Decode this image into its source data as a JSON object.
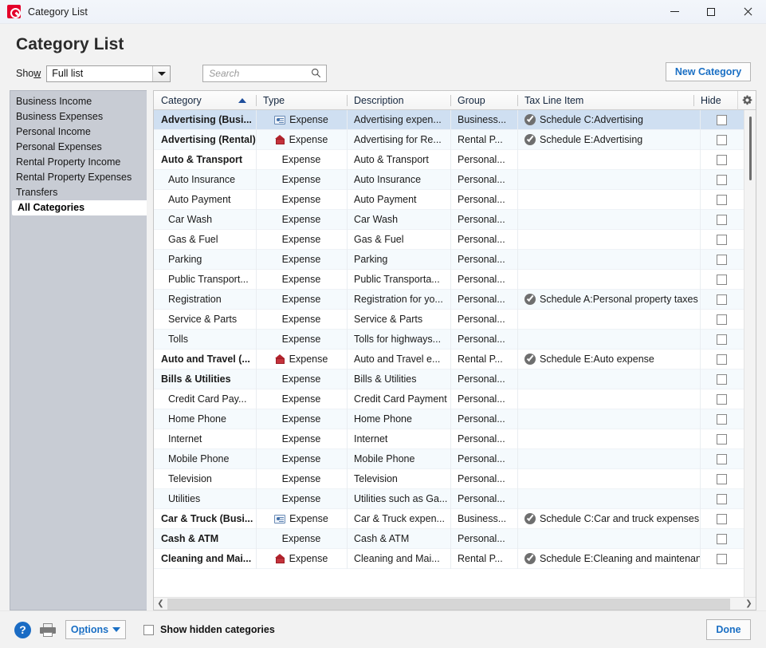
{
  "window": {
    "title": "Category List",
    "logo_icon": "quicken-logo-icon",
    "controls": {
      "minimize": "minimize-icon",
      "maximize": "maximize-icon",
      "close": "close-icon"
    }
  },
  "header": {
    "page_title": "Category List"
  },
  "filter": {
    "show_label_pre": "Sho",
    "show_label_underlined": "w",
    "show_value": "Full list",
    "show_options": [
      "Full list"
    ],
    "search_placeholder": "Search",
    "search_value": "",
    "search_icon": "search-icon",
    "new_category_label": "New Category"
  },
  "sidebar": {
    "items": [
      {
        "label": "Business Income",
        "selected": false
      },
      {
        "label": "Business Expenses",
        "selected": false
      },
      {
        "label": "Personal Income",
        "selected": false
      },
      {
        "label": "Personal Expenses",
        "selected": false
      },
      {
        "label": "Rental Property Income",
        "selected": false
      },
      {
        "label": "Rental Property Expenses",
        "selected": false
      },
      {
        "label": "Transfers",
        "selected": false
      },
      {
        "label": "All Categories",
        "selected": true
      }
    ]
  },
  "table": {
    "columns": [
      {
        "key": "category",
        "label": "Category",
        "sorted": "asc"
      },
      {
        "key": "type",
        "label": "Type"
      },
      {
        "key": "description",
        "label": "Description"
      },
      {
        "key": "group",
        "label": "Group"
      },
      {
        "key": "tax_line_item",
        "label": "Tax Line Item"
      },
      {
        "key": "hide",
        "label": "Hide"
      }
    ],
    "settings_icon": "gear-icon",
    "rows": [
      {
        "category": "Advertising (Busi...",
        "bold": true,
        "indent": false,
        "type_icon": "business-card-icon",
        "type": "Expense",
        "description": "Advertising expen...",
        "group": "Business...",
        "tax_line_item": "Schedule C:Advertising",
        "tax_icon": "check-circle-icon",
        "hide": false,
        "selected": true
      },
      {
        "category": "Advertising (Rental)",
        "bold": true,
        "indent": false,
        "type_icon": "rental-house-icon",
        "type": "Expense",
        "description": "Advertising for Re...",
        "group": "Rental P...",
        "tax_line_item": "Schedule E:Advertising",
        "tax_icon": "check-circle-icon",
        "hide": false
      },
      {
        "category": "Auto & Transport",
        "bold": true,
        "indent": false,
        "type_icon": "",
        "type": "Expense",
        "description": "Auto & Transport",
        "group": "Personal...",
        "tax_line_item": "",
        "tax_icon": "",
        "hide": false
      },
      {
        "category": "Auto Insurance",
        "bold": false,
        "indent": true,
        "type_icon": "",
        "type": "Expense",
        "description": "Auto Insurance",
        "group": "Personal...",
        "tax_line_item": "",
        "tax_icon": "",
        "hide": false
      },
      {
        "category": "Auto Payment",
        "bold": false,
        "indent": true,
        "type_icon": "",
        "type": "Expense",
        "description": "Auto Payment",
        "group": "Personal...",
        "tax_line_item": "",
        "tax_icon": "",
        "hide": false
      },
      {
        "category": "Car Wash",
        "bold": false,
        "indent": true,
        "type_icon": "",
        "type": "Expense",
        "description": "Car Wash",
        "group": "Personal...",
        "tax_line_item": "",
        "tax_icon": "",
        "hide": false
      },
      {
        "category": "Gas & Fuel",
        "bold": false,
        "indent": true,
        "type_icon": "",
        "type": "Expense",
        "description": "Gas & Fuel",
        "group": "Personal...",
        "tax_line_item": "",
        "tax_icon": "",
        "hide": false
      },
      {
        "category": "Parking",
        "bold": false,
        "indent": true,
        "type_icon": "",
        "type": "Expense",
        "description": "Parking",
        "group": "Personal...",
        "tax_line_item": "",
        "tax_icon": "",
        "hide": false
      },
      {
        "category": "Public Transport...",
        "bold": false,
        "indent": true,
        "type_icon": "",
        "type": "Expense",
        "description": "Public Transporta...",
        "group": "Personal...",
        "tax_line_item": "",
        "tax_icon": "",
        "hide": false
      },
      {
        "category": "Registration",
        "bold": false,
        "indent": true,
        "type_icon": "",
        "type": "Expense",
        "description": "Registration for yo...",
        "group": "Personal...",
        "tax_line_item": "Schedule A:Personal property taxes",
        "tax_icon": "check-circle-icon",
        "hide": false
      },
      {
        "category": "Service & Parts",
        "bold": false,
        "indent": true,
        "type_icon": "",
        "type": "Expense",
        "description": "Service & Parts",
        "group": "Personal...",
        "tax_line_item": "",
        "tax_icon": "",
        "hide": false
      },
      {
        "category": "Tolls",
        "bold": false,
        "indent": true,
        "type_icon": "",
        "type": "Expense",
        "description": "Tolls for highways...",
        "group": "Personal...",
        "tax_line_item": "",
        "tax_icon": "",
        "hide": false
      },
      {
        "category": "Auto and Travel (...",
        "bold": true,
        "indent": false,
        "type_icon": "rental-house-icon",
        "type": "Expense",
        "description": "Auto and Travel e...",
        "group": "Rental P...",
        "tax_line_item": "Schedule E:Auto expense",
        "tax_icon": "check-circle-icon",
        "hide": false
      },
      {
        "category": "Bills & Utilities",
        "bold": true,
        "indent": false,
        "type_icon": "",
        "type": "Expense",
        "description": "Bills & Utilities",
        "group": "Personal...",
        "tax_line_item": "",
        "tax_icon": "",
        "hide": false
      },
      {
        "category": "Credit Card Pay...",
        "bold": false,
        "indent": true,
        "type_icon": "",
        "type": "Expense",
        "description": "Credit Card Payment",
        "group": "Personal...",
        "tax_line_item": "",
        "tax_icon": "",
        "hide": false
      },
      {
        "category": "Home Phone",
        "bold": false,
        "indent": true,
        "type_icon": "",
        "type": "Expense",
        "description": "Home Phone",
        "group": "Personal...",
        "tax_line_item": "",
        "tax_icon": "",
        "hide": false
      },
      {
        "category": "Internet",
        "bold": false,
        "indent": true,
        "type_icon": "",
        "type": "Expense",
        "description": "Internet",
        "group": "Personal...",
        "tax_line_item": "",
        "tax_icon": "",
        "hide": false
      },
      {
        "category": "Mobile Phone",
        "bold": false,
        "indent": true,
        "type_icon": "",
        "type": "Expense",
        "description": "Mobile Phone",
        "group": "Personal...",
        "tax_line_item": "",
        "tax_icon": "",
        "hide": false
      },
      {
        "category": "Television",
        "bold": false,
        "indent": true,
        "type_icon": "",
        "type": "Expense",
        "description": "Television",
        "group": "Personal...",
        "tax_line_item": "",
        "tax_icon": "",
        "hide": false
      },
      {
        "category": "Utilities",
        "bold": false,
        "indent": true,
        "type_icon": "",
        "type": "Expense",
        "description": "Utilities such as Ga...",
        "group": "Personal...",
        "tax_line_item": "",
        "tax_icon": "",
        "hide": false
      },
      {
        "category": "Car & Truck (Busi...",
        "bold": true,
        "indent": false,
        "type_icon": "business-card-icon",
        "type": "Expense",
        "description": "Car & Truck expen...",
        "group": "Business...",
        "tax_line_item": "Schedule C:Car and truck expenses",
        "tax_icon": "check-circle-icon",
        "hide": false
      },
      {
        "category": "Cash & ATM",
        "bold": true,
        "indent": false,
        "type_icon": "",
        "type": "Expense",
        "description": "Cash & ATM",
        "group": "Personal...",
        "tax_line_item": "",
        "tax_icon": "",
        "hide": false
      },
      {
        "category": "Cleaning and Mai...",
        "bold": true,
        "indent": false,
        "type_icon": "rental-house-icon",
        "type": "Expense",
        "description": "Cleaning and Mai...",
        "group": "Rental P...",
        "tax_line_item": "Schedule E:Cleaning and maintenance",
        "tax_icon": "check-circle-icon",
        "hide": false
      }
    ]
  },
  "footer": {
    "help_label": "?",
    "help_icon": "help-icon",
    "print_icon": "print-icon",
    "options_label_pre": "O",
    "options_label_underlined": "p",
    "options_label_post": "tions",
    "options_full_label": "Options",
    "show_hidden_label": "Show hidden categories",
    "show_hidden_checked": false,
    "done_label": "Done"
  },
  "colors": {
    "accent_link": "#1a6fc4",
    "brand_red": "#e4002b",
    "selected_row": "#cfdff1",
    "sidebar_bg": "#c8ccd4",
    "alt_row": "#f5fafd"
  }
}
